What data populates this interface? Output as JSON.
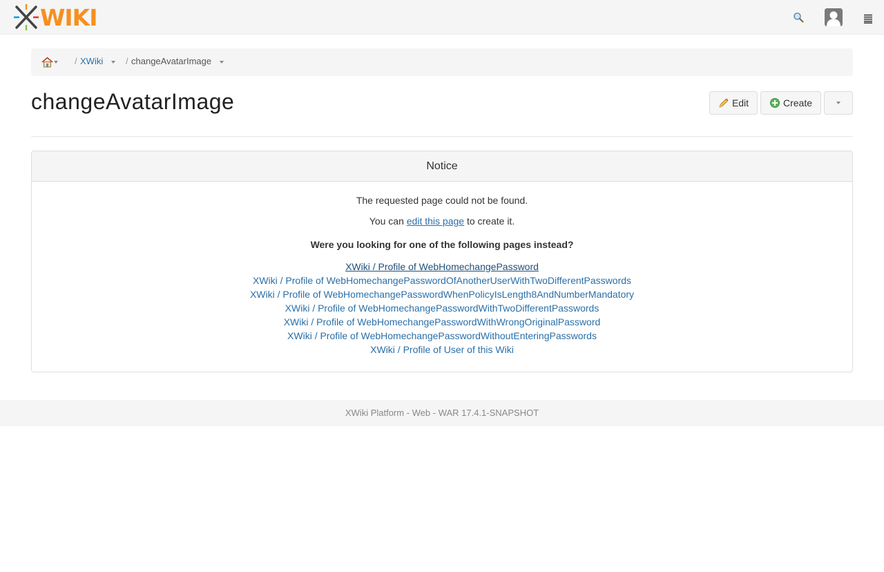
{
  "app": {
    "logo_text": "WIKI",
    "logo_icon": "xwiki-x-logo",
    "search_icon": "search-icon",
    "avatar_icon": "user-avatar-icon",
    "menu_icon": "drawer-menu-icon"
  },
  "breadcrumb": {
    "home_icon": "home-icon",
    "sep": "/",
    "items": [
      {
        "label": "XWiki"
      },
      {
        "label": "changeAvatarImage"
      }
    ]
  },
  "page": {
    "title": "changeAvatarImage",
    "actions": {
      "edit_label": "Edit",
      "create_label": "Create"
    }
  },
  "notice": {
    "heading": "Notice",
    "not_found": "The requested page could not be found.",
    "you_can_prefix": "You can ",
    "edit_link": "edit this page",
    "you_can_suffix": " to create it.",
    "question": "Were you looking for one of the following pages instead?",
    "suggestions": [
      "XWiki / Profile of WebHomechangePassword",
      "XWiki / Profile of WebHomechangePasswordOfAnotherUserWithTwoDifferentPasswords",
      "XWiki / Profile of WebHomechangePasswordWhenPolicyIsLength8AndNumberMandatory",
      "XWiki / Profile of WebHomechangePasswordWithTwoDifferentPasswords",
      "XWiki / Profile of WebHomechangePasswordWithWrongOriginalPassword",
      "XWiki / Profile of WebHomechangePasswordWithoutEnteringPasswords",
      "XWiki / Profile of User of this Wiki"
    ]
  },
  "footer": {
    "text": "XWiki Platform - Web - WAR 17.4.1-SNAPSHOT"
  },
  "colors": {
    "link": "#2a6fa8",
    "logo_orange": "#f6901e",
    "navbar_bg": "#f5f5f5"
  }
}
